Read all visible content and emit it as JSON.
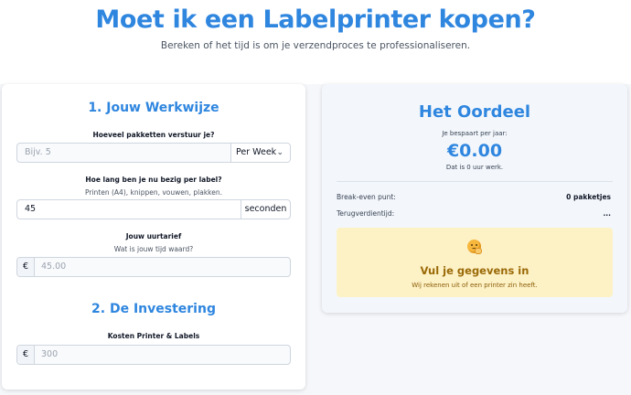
{
  "header": {
    "title": "Moet ik een Labelprinter kopen?",
    "subtitle": "Bereken of het tijd is om je verzendproces te professionaliseren."
  },
  "workflow": {
    "section_title": "1. Jouw Werkwijze",
    "packages": {
      "label": "Hoeveel pakketten verstuur je?",
      "value": "",
      "placeholder": "Bijv. 5",
      "period": "Per Week"
    },
    "time": {
      "label": "Hoe lang ben je nu bezig per label?",
      "help": "Printen (A4), knippen, vouwen, plakken.",
      "value": "45",
      "unit": "seconden"
    },
    "rate": {
      "label": "Jouw uurtarief",
      "help": "Wat is jouw tijd waard?",
      "prefix": "€",
      "value": "",
      "placeholder": "45.00"
    }
  },
  "investment": {
    "section_title": "2. De Investering",
    "cost": {
      "label": "Kosten Printer & Labels",
      "prefix": "€",
      "value": "",
      "placeholder": "300"
    }
  },
  "verdict": {
    "title": "Het Oordeel",
    "savings_label": "Je bespaart per jaar:",
    "savings_amount": "€0.00",
    "hours_note": "Dat is 0 uur werk.",
    "break_even_label": "Break-even punt:",
    "break_even_value": "0 pakketjes",
    "payback_label": "Terugverdientijd:",
    "payback_value": "...",
    "notice": {
      "icon": "thinking-face-icon",
      "title": "Vul je gegevens in",
      "text": "Wij rekenen uit of een printer zin heeft."
    }
  },
  "colors": {
    "accent": "#2f86df",
    "notice_bg": "#fdf1c6",
    "notice_text": "#9a6a07"
  }
}
